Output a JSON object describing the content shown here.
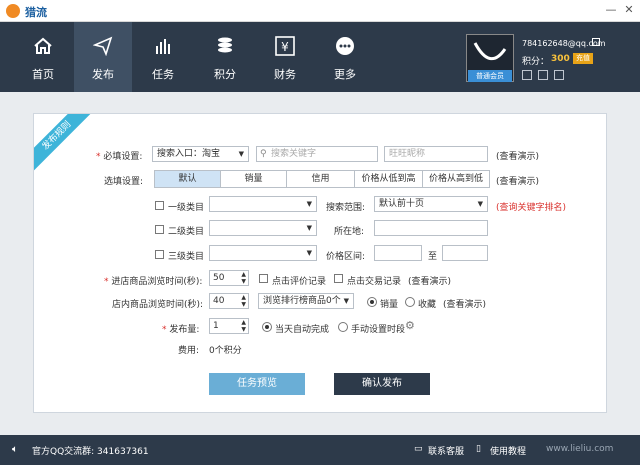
{
  "app": {
    "title": "猎流"
  },
  "nav": {
    "items": [
      {
        "label": "首页",
        "icon": "home-icon"
      },
      {
        "label": "发布",
        "icon": "send-icon"
      },
      {
        "label": "任务",
        "icon": "bar-chart-icon"
      },
      {
        "label": "积分",
        "icon": "coins-icon"
      },
      {
        "label": "财务",
        "icon": "yen-icon"
      },
      {
        "label": "更多",
        "icon": "more-icon"
      }
    ]
  },
  "user": {
    "email": "784162648@qq.com",
    "score_label": "积分：",
    "score": "300",
    "recharge": "充值",
    "badge": "普通会员"
  },
  "ribbon": "发布规则",
  "form": {
    "required_label": "必填设置:",
    "search_entry": "搜索入口：淘宝",
    "keyword_placeholder": "搜索关键字",
    "wangwang_placeholder": "旺旺昵称",
    "view_demo": "(查看演示)",
    "optional_label": "选填设置:",
    "sort_tabs": [
      "默认",
      "销量",
      "信用",
      "价格从低到高",
      "价格从高到低"
    ],
    "cat1": "一级类目",
    "cat2": "二级类目",
    "cat3": "三级类目",
    "search_range_label": "搜索范围:",
    "search_range": "默认前十页",
    "query_rank": "(查询关键字排名)",
    "location_label": "所在地:",
    "price_range_label": "价格区间:",
    "price_to": "至",
    "browse_time_label": "进店商品浏览时间(秒):",
    "browse_time": "50",
    "click_review": "点击评价记录",
    "click_trade": "点击交易记录",
    "in_store_label": "店内商品浏览时间(秒):",
    "in_store_time": "40",
    "browse_rank": "浏览排行榜商品0个",
    "sales": "销量",
    "favorite": "收藏",
    "publish_count_label": "发布量:",
    "publish_count": "1",
    "auto_finish": "当天自动完成",
    "manual_time": "手动设置时段",
    "cost_label": "费用:",
    "cost_value": "0个积分",
    "preview_btn": "任务预览",
    "confirm_btn": "确认发布"
  },
  "footer": {
    "qq_group": "官方QQ交流群: 341637361",
    "support": "联系客服",
    "tutorial": "使用教程",
    "site": "www.lieliu.com"
  }
}
